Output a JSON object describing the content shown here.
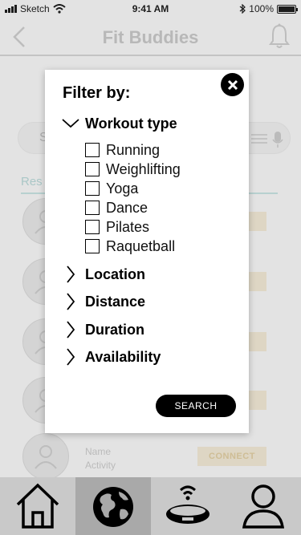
{
  "status_bar": {
    "carrier": "Sketch",
    "time": "9:41 AM",
    "battery": "100%"
  },
  "nav": {
    "title": "Fit Buddies",
    "back_icon": "chevron-left-icon",
    "bell_icon": "bell-icon"
  },
  "search": {
    "placeholder": "S"
  },
  "results": {
    "tab_label": "Res",
    "rows": [
      {
        "name": "",
        "activity": "",
        "connect": "CT"
      },
      {
        "name": "",
        "activity": "",
        "connect": "CT"
      },
      {
        "name": "",
        "activity": "",
        "connect": "CT"
      },
      {
        "name": "",
        "activity": "",
        "connect": "CT"
      },
      {
        "name": "Name",
        "activity": "Activity",
        "connect": "CONNECT"
      }
    ]
  },
  "filter": {
    "title": "Filter by:",
    "close_icon": "close-icon",
    "sections": [
      {
        "label": "Workout type",
        "expanded": true,
        "options": [
          "Running",
          "Weighlifting",
          "Yoga",
          "Dance",
          "Pilates",
          "Raquetball"
        ]
      },
      {
        "label": "Location",
        "expanded": false
      },
      {
        "label": "Distance",
        "expanded": false
      },
      {
        "label": "Duration",
        "expanded": false
      },
      {
        "label": "Availability",
        "expanded": false
      }
    ],
    "search_button": "SEARCH"
  },
  "tabs": [
    {
      "name": "home",
      "icon": "home-icon",
      "active": false
    },
    {
      "name": "explore",
      "icon": "globe-icon",
      "active": true
    },
    {
      "name": "device",
      "icon": "wristband-icon",
      "active": false
    },
    {
      "name": "profile",
      "icon": "person-icon",
      "active": false
    }
  ],
  "colors": {
    "connect_bg": "#f9efd8",
    "connect_text": "#e5cf9c",
    "tab_bar": "#c9c9c9",
    "tab_active": "#a9a9a9",
    "results_accent": "#b7dcdb"
  }
}
